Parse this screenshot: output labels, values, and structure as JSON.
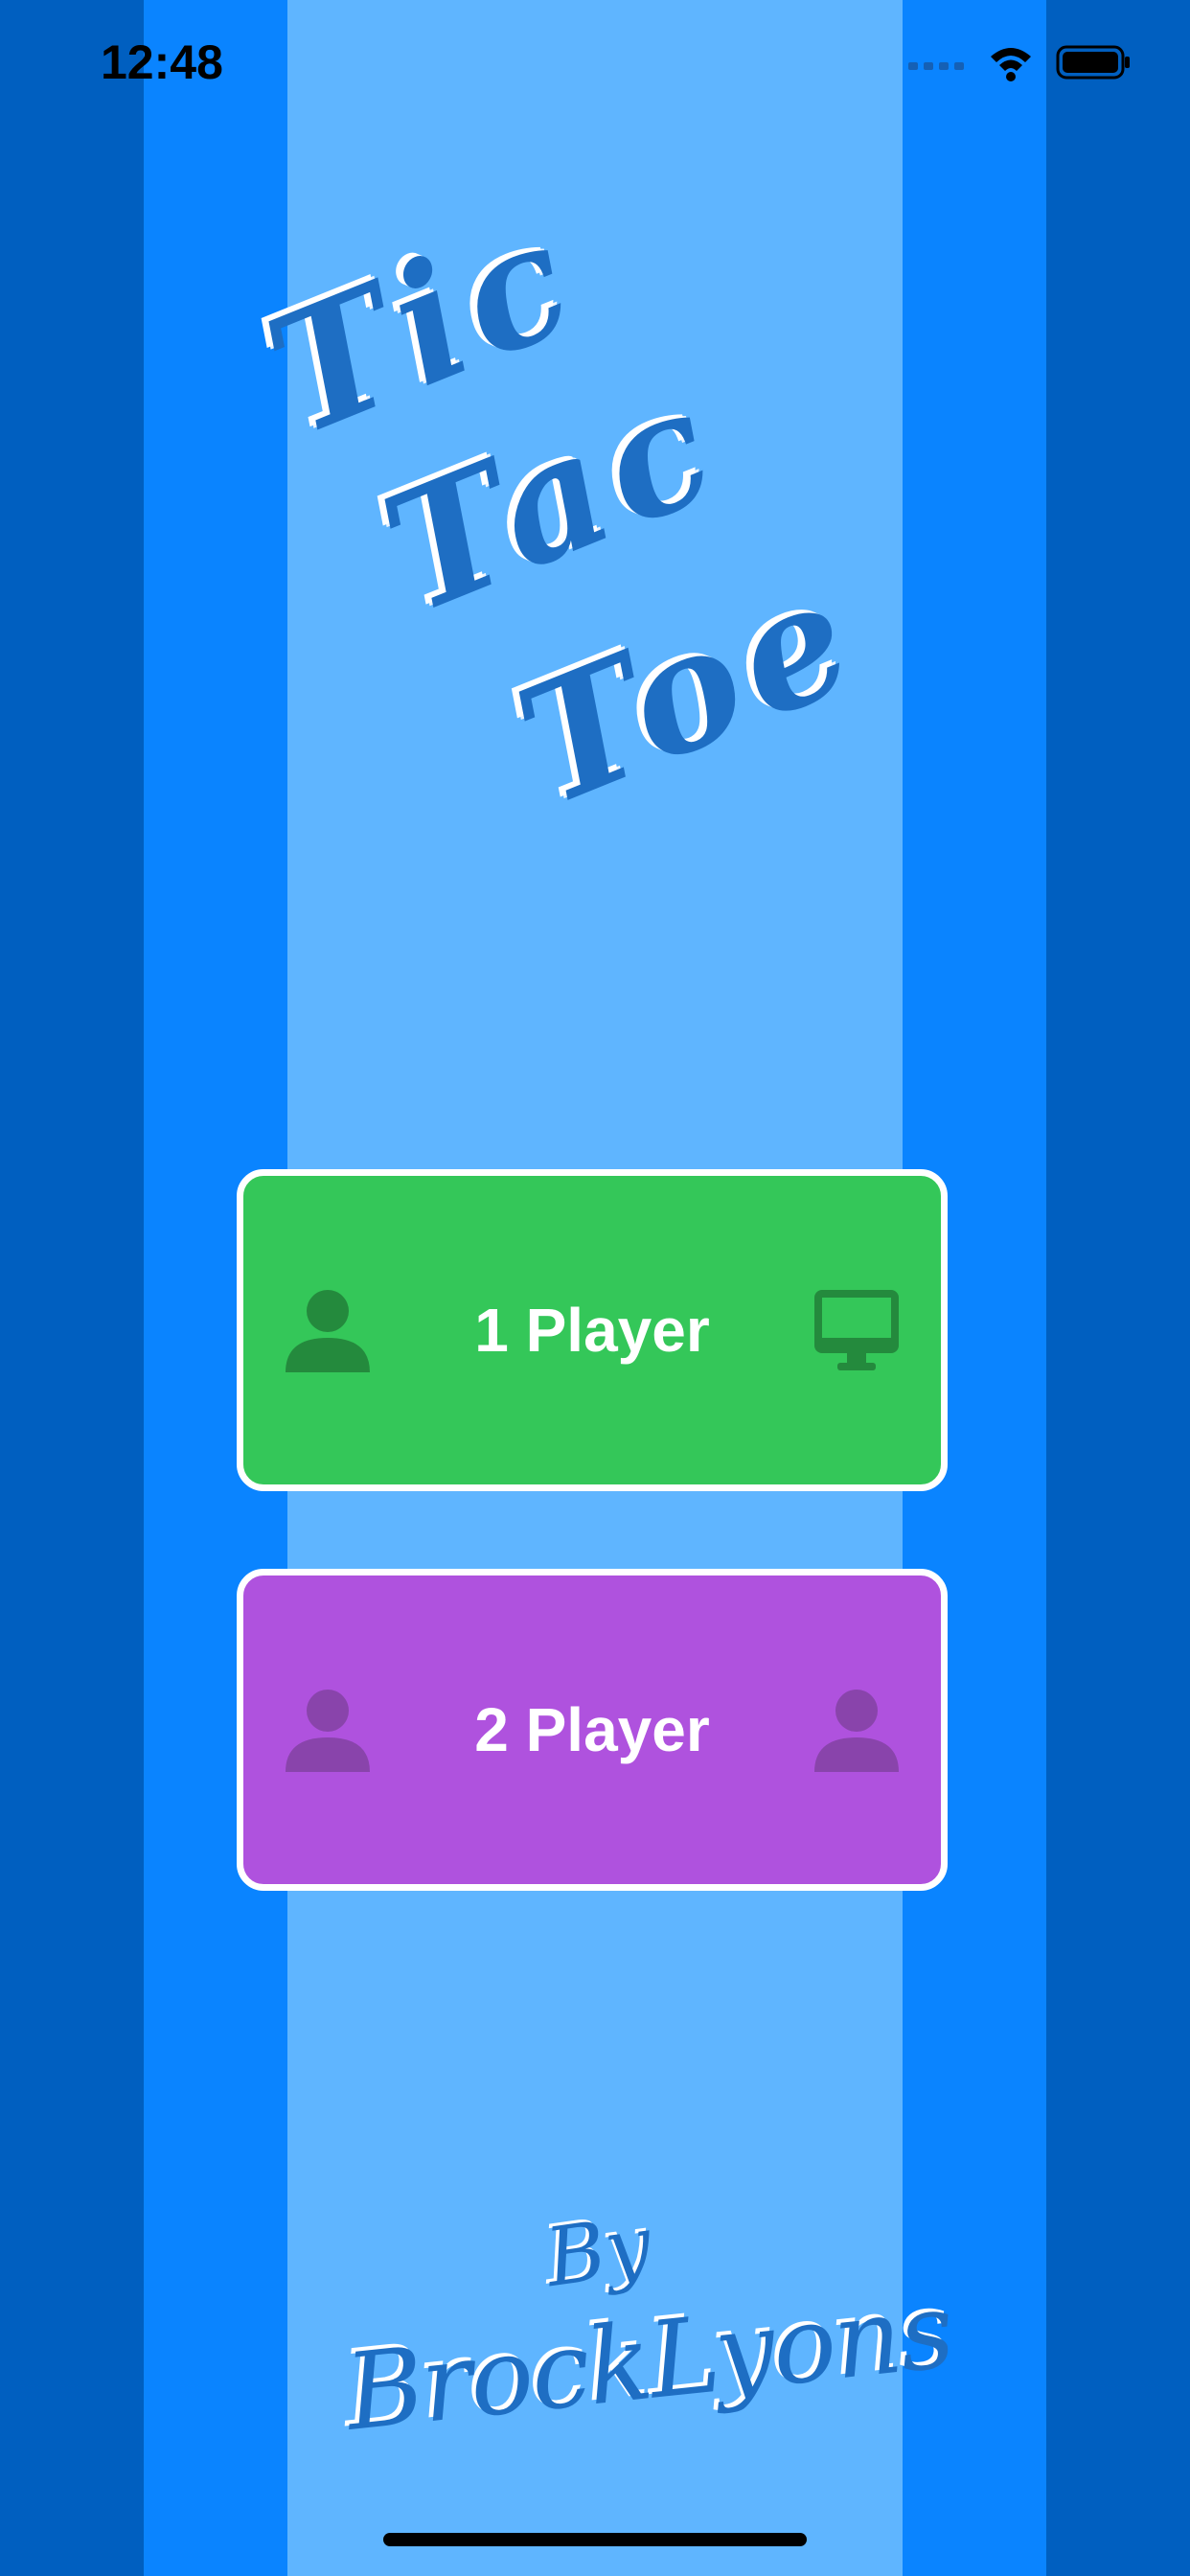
{
  "status_bar": {
    "time": "12:48"
  },
  "title": {
    "line1": "Tic",
    "line2": "Tac",
    "line3": "Toe"
  },
  "menu": {
    "one_player": {
      "label": "1 Player",
      "left_icon": "person-icon",
      "right_icon": "desktop-computer-icon"
    },
    "two_player": {
      "label": "2 Player",
      "left_icon": "person-icon",
      "right_icon": "person-icon"
    }
  },
  "credit": {
    "by": "By",
    "author": "BrockLyons"
  },
  "colors": {
    "outer_stripe": "#005FC0",
    "middle_stripe": "#0A84FF",
    "center_stripe": "#5FB5FF",
    "one_player_button": "#34C759",
    "two_player_button": "#AF52DE",
    "title_ink": "#1E6EC3"
  }
}
